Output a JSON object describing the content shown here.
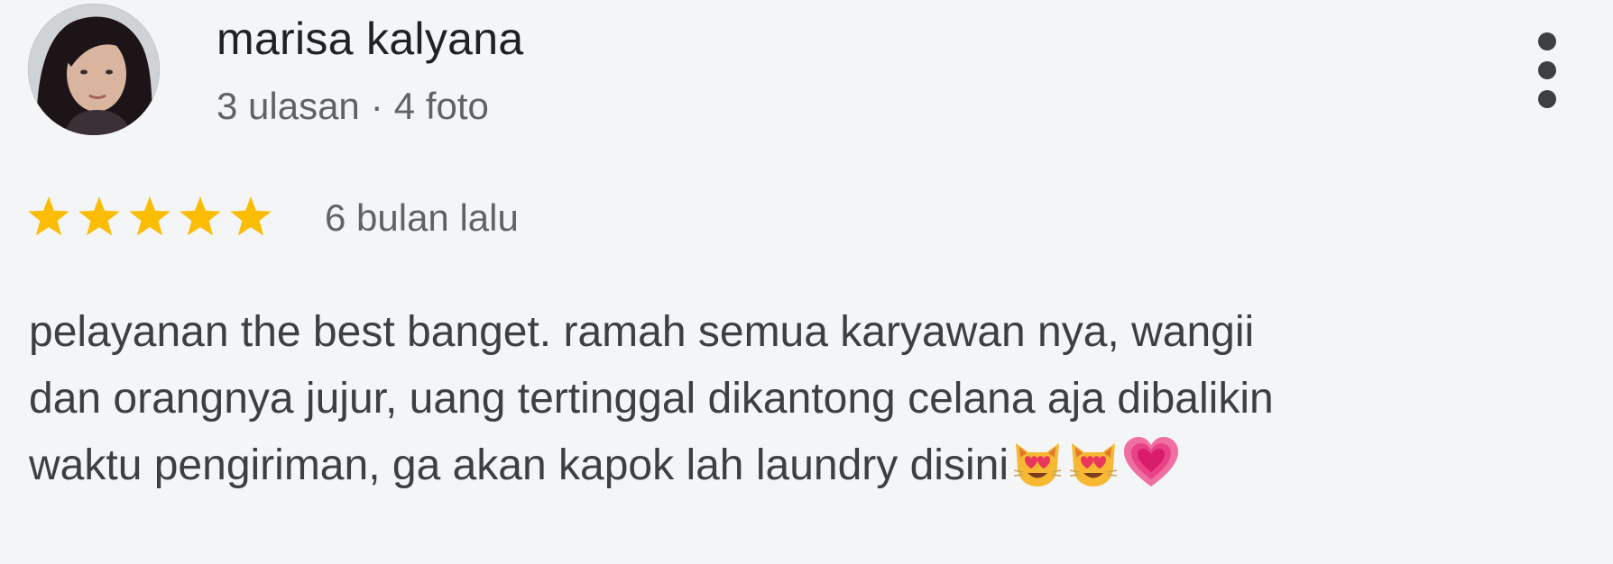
{
  "reviewer": {
    "name": "marisa kalyana",
    "reviews": "3 ulasan",
    "separator": "·",
    "photos": "4 foto",
    "avatar_icon": "profile-photo"
  },
  "rating": {
    "stars": 5,
    "max": 5,
    "star_color": "#fbbc04",
    "time": "6 bulan lalu"
  },
  "review": {
    "lines": [
      "pelayanan the best banget. ramah semua karyawan nya, wangii",
      "dan orangnya jujur, uang tertinggal dikantong celana aja dibalikin",
      "waktu pengiriman, ga akan kapok lah laundry disini"
    ],
    "emojis": [
      "smiling-cat-heart-eyes-emoji",
      "smiling-cat-heart-eyes-emoji",
      "growing-heart-emoji"
    ]
  },
  "menu_icon": "more-vertical-icon"
}
